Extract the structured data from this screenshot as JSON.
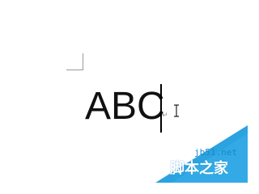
{
  "document": {
    "text": "ABC",
    "paragraph_mark": "↵"
  },
  "watermark": {
    "site": "jb51.net",
    "name": "脚本之家",
    "color": "#2aa3e0"
  },
  "colors": {
    "background": "#ffffff",
    "text": "#111111",
    "caret": "#000000"
  },
  "icons": {
    "cursor": "text-ibeam-cursor"
  }
}
